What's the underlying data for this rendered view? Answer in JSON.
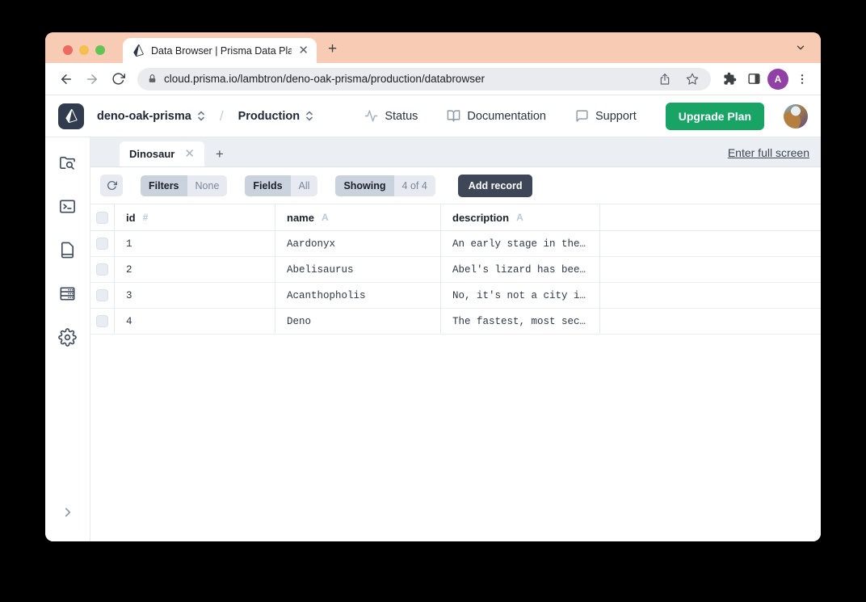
{
  "browser": {
    "tab_title": "Data Browser | Prisma Data Pla",
    "url": "cloud.prisma.io/lambtron/deno-oak-prisma/production/databrowser",
    "profile_letter": "A"
  },
  "header": {
    "project": "deno-oak-prisma",
    "environment": "Production",
    "nav": [
      {
        "label": "Status"
      },
      {
        "label": "Documentation"
      },
      {
        "label": "Support"
      }
    ],
    "upgrade_label": "Upgrade Plan"
  },
  "model_tabs": {
    "active_tab": "Dinosaur",
    "fullscreen_link": "Enter full screen"
  },
  "toolbar": {
    "filters_label": "Filters",
    "filters_value": "None",
    "fields_label": "Fields",
    "fields_value": "All",
    "showing_label": "Showing",
    "showing_value": "4 of 4",
    "add_record_label": "Add record"
  },
  "table": {
    "columns": [
      {
        "name": "id",
        "type": "#"
      },
      {
        "name": "name",
        "type": "A"
      },
      {
        "name": "description",
        "type": "A"
      }
    ],
    "rows": [
      {
        "id": "1",
        "name": "Aardonyx",
        "description": "An early stage in the…"
      },
      {
        "id": "2",
        "name": "Abelisaurus",
        "description": "Abel's lizard has bee…"
      },
      {
        "id": "3",
        "name": "Acanthopholis",
        "description": "No, it's not a city i…"
      },
      {
        "id": "4",
        "name": "Deno",
        "description": "The fastest, most sec…"
      }
    ]
  },
  "colors": {
    "accent_green": "#18A464",
    "dark_slate": "#3D4757",
    "titlebar_peach": "#F8CCB4",
    "chrome_avatar_purple": "#9140A5"
  }
}
